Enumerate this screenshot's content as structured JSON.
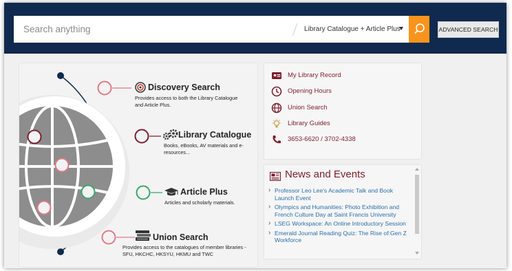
{
  "search": {
    "placeholder": "Search anything",
    "scope": "Library Catalogue + Article Plus",
    "advanced_label": "ADVANCED SEARCH"
  },
  "features": [
    {
      "title": "Discovery Search",
      "desc": "Provides access to both the Library Catalogue and Article Plus.",
      "icon": "target-icon"
    },
    {
      "title": "Library Catalogue",
      "desc": "Books, eBooks, AV materials and e-resources...",
      "icon": "gears-icon"
    },
    {
      "title": "Article Plus",
      "desc": "Articles and scholarly materials.",
      "icon": "graduation-cap-icon"
    },
    {
      "title": "Union Search",
      "desc": "Provides access to the catalogues of member libraries - SFU, HKCHC, HKSYU, HKMU and TWC",
      "icon": "books-icon"
    }
  ],
  "quick_links": [
    {
      "label": "My Library Record",
      "icon": "id-card-icon"
    },
    {
      "label": "Opening Hours",
      "icon": "clock-icon"
    },
    {
      "label": "Union Search",
      "icon": "globe-icon"
    },
    {
      "label": "Library Guides",
      "icon": "lightbulb-icon"
    },
    {
      "label": "3653-6620 / 3702-4338",
      "icon": "phone-icon"
    }
  ],
  "news": {
    "title": "News and Events",
    "items": [
      "Professor Leo Lee's Academic Talk and Book Launch Event",
      "Olympics and Humanities: Photo Exhibition and French Culture Day at Saint Francis University",
      "LSEG Workspace: An Online Introductory Session",
      "Emerald Journal Reading Quiz: The Rise of Gen Z Workforce"
    ]
  },
  "colors": {
    "header_bg": "#0f2a4e",
    "accent_orange": "#f7941d",
    "maroon": "#7a1f2b",
    "link_blue": "#2a6fa8",
    "node_pink": "#e07a86",
    "node_green": "#3aa66a"
  }
}
